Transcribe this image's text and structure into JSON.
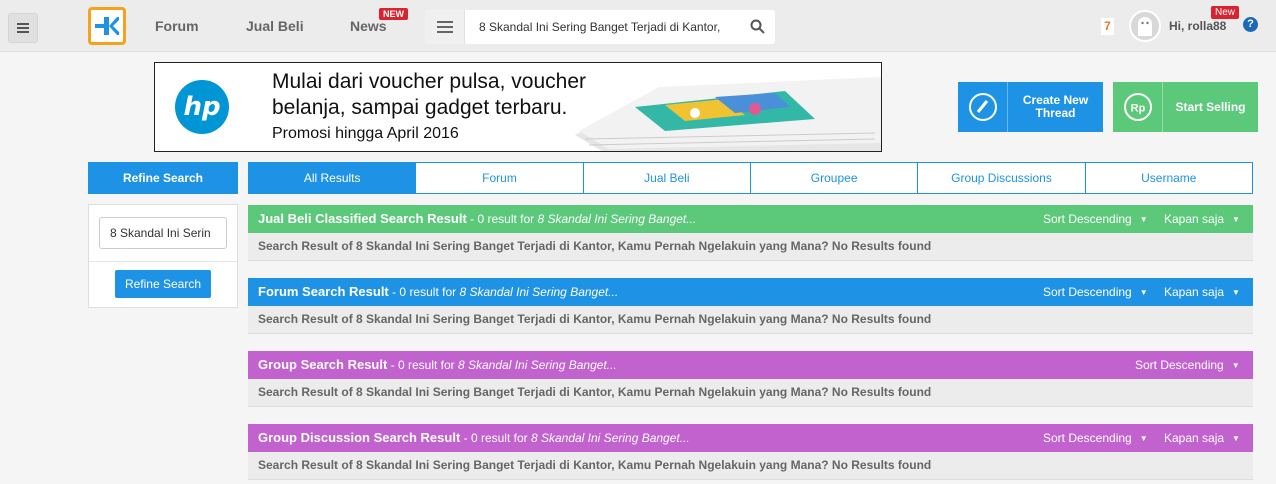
{
  "topbar": {
    "nav": [
      "Forum",
      "Jual Beli",
      "News"
    ],
    "new_badge": "NEW",
    "search_value": "8 Skandal Ini Sering Banget Terjadi di Kantor,",
    "notif_count": "7",
    "greeting": "Hi, rolla88",
    "user_new_badge": "New",
    "help": "?"
  },
  "banner": {
    "brand": "hp",
    "line1": "Mulai dari voucher pulsa, voucher",
    "line2": "belanja, sampai gadget terbaru.",
    "line3": "Promosi hingga April 2016"
  },
  "actions": {
    "create_thread": "Create New Thread",
    "start_selling": "Start Selling",
    "rp_symbol": "Rp"
  },
  "sidebar": {
    "header": "Refine Search",
    "input_value": "8 Skandal Ini Serin",
    "button": "Refine Search"
  },
  "tabs": [
    "All Results",
    "Forum",
    "Jual Beli",
    "Groupee",
    "Group Discussions",
    "Username"
  ],
  "results": [
    {
      "title": "Jual Beli Classified Search Result",
      "summary": " - 0 result for ",
      "query": "8 Skandal Ini Sering Banget...",
      "sort": "Sort Descending",
      "time": "Kapan saja",
      "body": "Search Result of 8 Skandal Ini Sering Banget Terjadi di Kantor, Kamu Pernah Ngelakuin yang Mana? No Results found",
      "color": "#5cc97a"
    },
    {
      "title": "Forum Search Result",
      "summary": " - 0 result for ",
      "query": "8 Skandal Ini Sering Banget...",
      "sort": "Sort Descending",
      "time": "Kapan saja",
      "body": "Search Result of 8 Skandal Ini Sering Banget Terjadi di Kantor, Kamu Pernah Ngelakuin yang Mana? No Results found",
      "color": "#1e93e6"
    },
    {
      "title": "Group Search Result",
      "summary": " - 0 result for ",
      "query": "8 Skandal Ini Sering Banget...",
      "sort": "Sort Descending",
      "body": "Search Result of 8 Skandal Ini Sering Banget Terjadi di Kantor, Kamu Pernah Ngelakuin yang Mana? No Results found",
      "color": "#c162cf"
    },
    {
      "title": "Group Discussion Search Result",
      "summary": " - 0 result for ",
      "query": "8 Skandal Ini Sering Banget...",
      "sort": "Sort Descending",
      "time": "Kapan saja",
      "body": "Search Result of 8 Skandal Ini Sering Banget Terjadi di Kantor, Kamu Pernah Ngelakuin yang Mana? No Results found",
      "color": "#c162cf"
    }
  ],
  "colors": {
    "accent": "#1e93e6",
    "green": "#5cc97a",
    "purple": "#c162cf",
    "logo_orange": "#f7a21b"
  }
}
